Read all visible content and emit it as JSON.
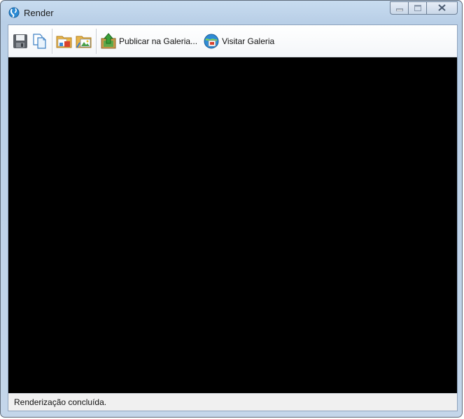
{
  "window": {
    "title": "Render",
    "icon": "globe-icon"
  },
  "caption_buttons": {
    "minimize_icon": "minimize-icon",
    "maximize_icon": "maximize-icon",
    "close_icon": "close-icon"
  },
  "toolbar": {
    "save_icon": "save-icon",
    "copy_icon": "copy-document-icon",
    "open_folder_icon": "open-folder-icon",
    "folder_image_icon": "folder-image-icon",
    "publish_label": "Publicar na Galeria...",
    "publish_icon": "upload-gallery-icon",
    "visit_label": "Visitar Galeria",
    "visit_icon": "visit-gallery-icon"
  },
  "canvas": {
    "background": "#000000"
  },
  "status": {
    "text": "Renderização concluída."
  },
  "colors": {
    "frame": "#c4d6ea",
    "accent": "#2a8ad4"
  }
}
